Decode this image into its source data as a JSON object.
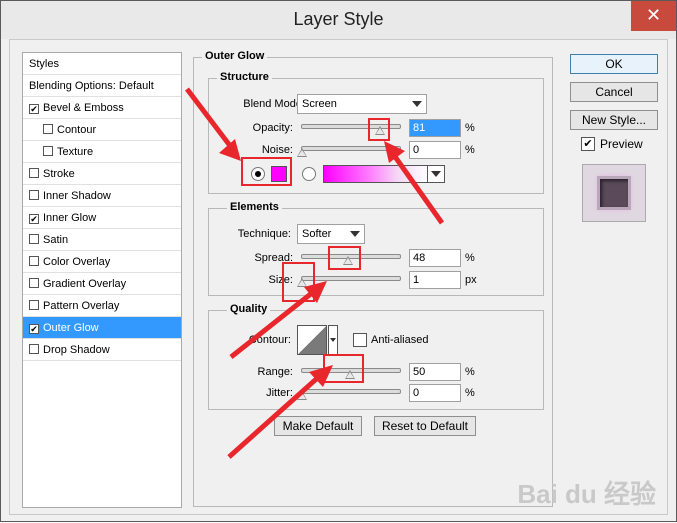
{
  "window": {
    "title": "Layer Style",
    "close_glyph": "✕"
  },
  "styles_list": {
    "items": [
      {
        "label": "Styles",
        "checked": null,
        "sub": false,
        "selected": false
      },
      {
        "label": "Blending Options: Default",
        "checked": null,
        "sub": false,
        "selected": false
      },
      {
        "label": "Bevel & Emboss",
        "checked": true,
        "sub": false,
        "selected": false
      },
      {
        "label": "Contour",
        "checked": false,
        "sub": true,
        "selected": false
      },
      {
        "label": "Texture",
        "checked": false,
        "sub": true,
        "selected": false
      },
      {
        "label": "Stroke",
        "checked": false,
        "sub": false,
        "selected": false
      },
      {
        "label": "Inner Shadow",
        "checked": false,
        "sub": false,
        "selected": false
      },
      {
        "label": "Inner Glow",
        "checked": true,
        "sub": false,
        "selected": false
      },
      {
        "label": "Satin",
        "checked": false,
        "sub": false,
        "selected": false
      },
      {
        "label": "Color Overlay",
        "checked": false,
        "sub": false,
        "selected": false
      },
      {
        "label": "Gradient Overlay",
        "checked": false,
        "sub": false,
        "selected": false
      },
      {
        "label": "Pattern Overlay",
        "checked": false,
        "sub": false,
        "selected": false
      },
      {
        "label": "Outer Glow",
        "checked": true,
        "sub": false,
        "selected": true
      },
      {
        "label": "Drop Shadow",
        "checked": false,
        "sub": false,
        "selected": false
      }
    ]
  },
  "outer_glow": {
    "title": "Outer Glow",
    "structure": {
      "title": "Structure",
      "blend_mode_label": "Blend Mode:",
      "blend_mode_value": "Screen",
      "opacity_label": "Opacity:",
      "opacity_value": "81",
      "opacity_unit": "%",
      "noise_label": "Noise:",
      "noise_value": "0",
      "noise_unit": "%",
      "glow_color": "#ff00ff"
    },
    "elements": {
      "title": "Elements",
      "technique_label": "Technique:",
      "technique_value": "Softer",
      "spread_label": "Spread:",
      "spread_value": "48",
      "spread_unit": "%",
      "size_label": "Size:",
      "size_value": "1",
      "size_unit": "px"
    },
    "quality": {
      "title": "Quality",
      "contour_label": "Contour:",
      "anti_aliased_label": "Anti-aliased",
      "range_label": "Range:",
      "range_value": "50",
      "range_unit": "%",
      "jitter_label": "Jitter:",
      "jitter_value": "0",
      "jitter_unit": "%"
    },
    "make_default_label": "Make Default",
    "reset_default_label": "Reset to Default"
  },
  "buttons": {
    "ok_label": "OK",
    "cancel_label": "Cancel",
    "new_style_label": "New Style...",
    "preview_label": "Preview"
  },
  "watermark": "Bai du 经验"
}
